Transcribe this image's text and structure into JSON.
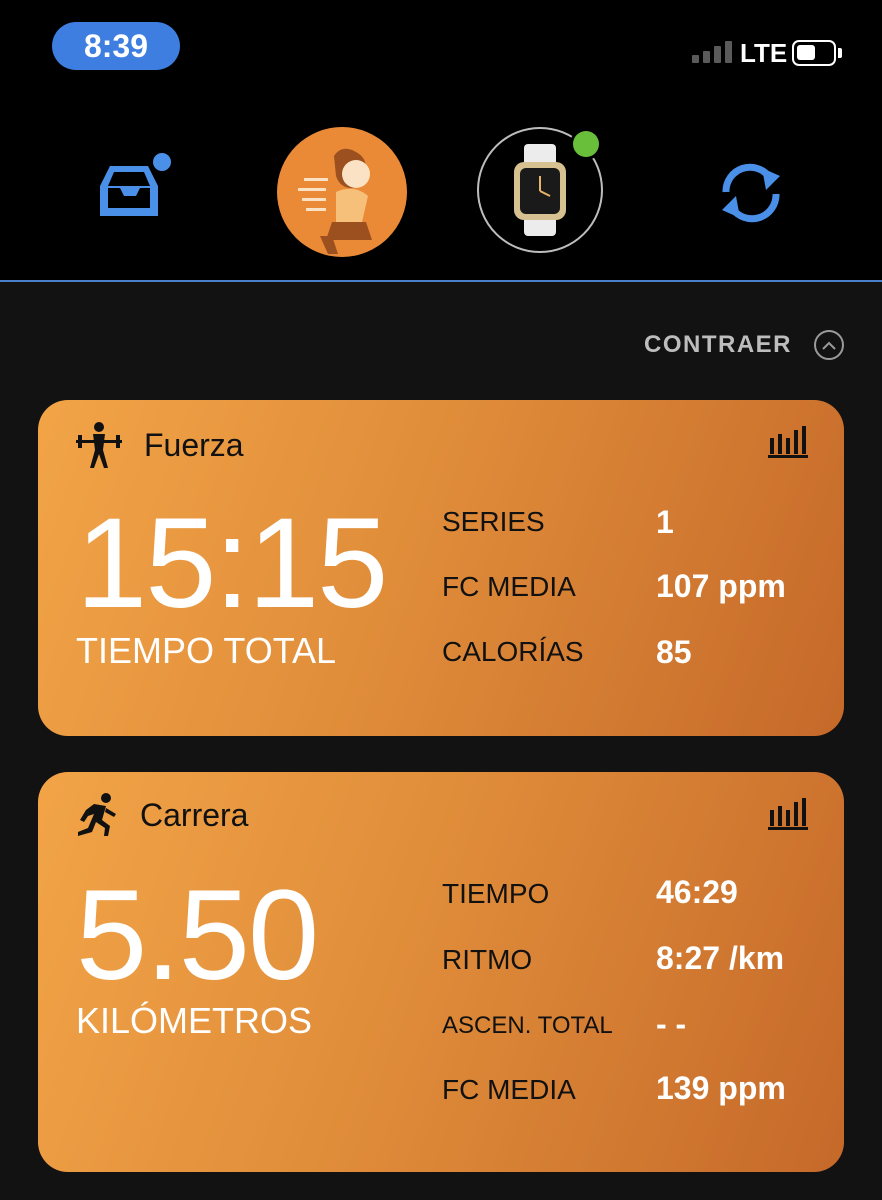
{
  "status_bar": {
    "time": "8:39",
    "network": "LTE"
  },
  "nav": {
    "items": [
      {
        "name": "inbox",
        "icon": "inbox-tray-icon",
        "has_badge": true
      },
      {
        "name": "profile",
        "icon": "runner-avatar-icon"
      },
      {
        "name": "device",
        "icon": "smartwatch-icon",
        "connected": true
      },
      {
        "name": "sync",
        "icon": "sync-icon"
      }
    ]
  },
  "collapse_label": "CONTRAER",
  "activities": [
    {
      "icon": "weightlifting-icon",
      "title": "Fuerza",
      "primary_value": "15:15",
      "primary_label": "TIEMPO TOTAL",
      "stats": [
        {
          "label": "SERIES",
          "value": "1"
        },
        {
          "label": "FC MEDIA",
          "value": "107 ppm"
        },
        {
          "label": "CALORÍAS",
          "value": "85"
        }
      ]
    },
    {
      "icon": "running-icon",
      "title": "Carrera",
      "primary_value": "5.50",
      "primary_label": "KILÓMETROS",
      "stats": [
        {
          "label": "TIEMPO",
          "value": "46:29"
        },
        {
          "label": "RITMO",
          "value": "8:27 /km"
        },
        {
          "label": "ASCEN. TOTAL",
          "value": "- -"
        },
        {
          "label": "FC MEDIA",
          "value": "139 ppm"
        }
      ]
    }
  ],
  "colors": {
    "accent_blue": "#3d7ee0",
    "card_orange_start": "#f2a447",
    "card_orange_end": "#c5692a",
    "connected_green": "#6abf3a",
    "background": "#121212"
  }
}
